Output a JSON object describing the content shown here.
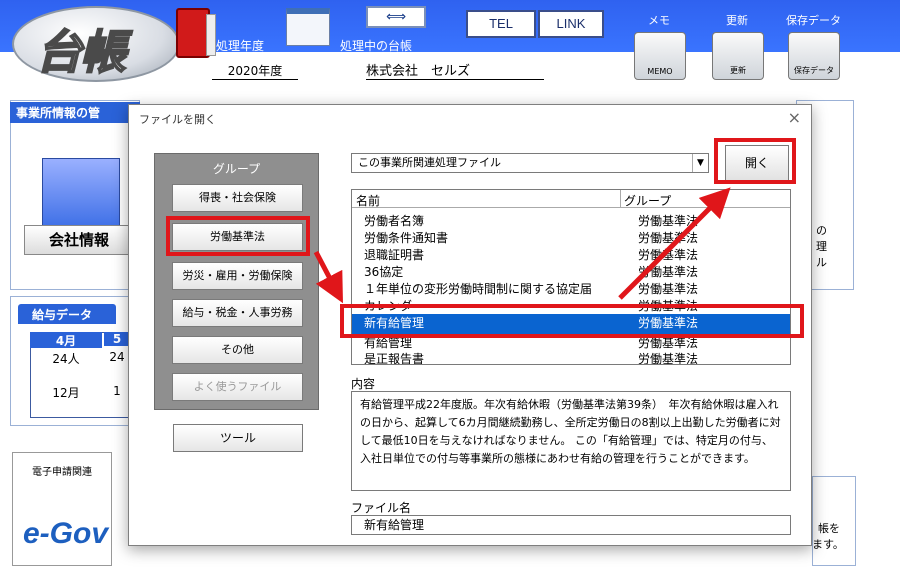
{
  "app": {
    "logo_text": "台帳",
    "year_label": "処理年度",
    "year_value": "2020年度",
    "ledger_label": "処理中の台帳",
    "company_value": "株式会社　セルズ",
    "tel_label": "TEL",
    "link_label": "LINK",
    "memo_label": "メモ",
    "update_label": "更新",
    "saved_label": "保存データ",
    "memo_icon_text": "MEMO",
    "update_icon_text": "更新",
    "saved_icon_text": "保存データ",
    "office_header": "事業所情報の管",
    "company_info": "会社情報",
    "salary_tab": "給与データ",
    "salary_month1": "4月",
    "salary_month2": "5",
    "salary_count1": "24人",
    "salary_count2": "24",
    "salary_month3": "12月",
    "salary_month4": "1",
    "egov_title": "電子申請関連",
    "egov_logo": "e-Gov",
    "right_partial": [
      "の",
      "理",
      "ル",
      "帳を",
      "ます。"
    ]
  },
  "dialog": {
    "title": "ファイルを開く",
    "close": "×",
    "group_title": "グループ",
    "groups": [
      "得喪・社会保険",
      "労働基準法",
      "労災・雇用・労働保険",
      "給与・税金・人事労務",
      "その他",
      "よく使うファイル"
    ],
    "tool_button": "ツール",
    "combo_value": "この事業所関連処理ファイル",
    "open_button": "開く",
    "list_headers": {
      "name": "名前",
      "group": "グループ"
    },
    "files": [
      {
        "name": "労働者名簿",
        "group": "労働基準法"
      },
      {
        "name": "労働条件通知書",
        "group": "労働基準法"
      },
      {
        "name": "退職証明書",
        "group": "労働基準法"
      },
      {
        "name": "36協定",
        "group": "労働基準法"
      },
      {
        "name": "１年単位の変形労働時間制に関する協定届",
        "group": "労働基準法"
      },
      {
        "name": "カレンダ",
        "group": "労働基準法"
      },
      {
        "name": "新有給管理",
        "group": "労働基準法"
      },
      {
        "name": "有給管理",
        "group": "労働基準法"
      },
      {
        "name": "是正報告書",
        "group": "労働基準法"
      }
    ],
    "content_label": "内容",
    "content_text": "有給管理平成22年度版。年次有給休暇（労働基準法第39条）　年次有給休暇は雇入れの日から、起算して6カ月間継続勤務し、全所定労働日の8割以上出勤した労働者に対して最低10日を与えなければなりません。 この「有給管理」では、特定月の付与、入社日単位での付与等事業所の態様にあわせ有給の管理を行うことができます。",
    "filename_label": "ファイル名",
    "filename_value": "新有給管理"
  },
  "colors": {
    "accent": "#2a62d8",
    "selection": "#0a64d0",
    "highlight": "#e0161a"
  }
}
